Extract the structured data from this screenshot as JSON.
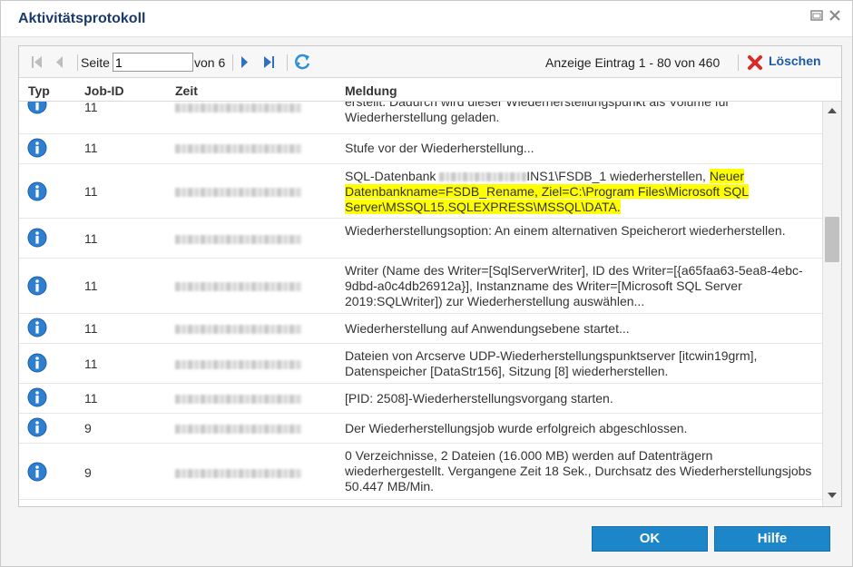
{
  "dialog": {
    "title": "Aktivitätsprotokoll",
    "window_buttons": [
      "restore-icon",
      "close-icon"
    ]
  },
  "toolbar": {
    "page_label": "Seite",
    "page_value": "1",
    "page_of": "von 6",
    "display_info": "Anzeige Eintrag 1 - 80 von 460",
    "delete_label": "Löschen",
    "icons": [
      "first-page-icon",
      "prev-page-icon",
      "next-page-icon",
      "last-page-icon",
      "refresh-icon",
      "delete-icon"
    ]
  },
  "grid": {
    "columns": [
      "Typ",
      "Job-ID",
      "Zeit",
      "Meldung"
    ],
    "rows": [
      {
        "type": "info-icon",
        "job_id": "11",
        "message": "erstellt. Dadurch wird dieser Wiederherstellungspunkt als Volume für Wiederherstellung geladen."
      },
      {
        "type": "info-icon",
        "job_id": "11",
        "message": "Stufe vor der Wiederherstellung..."
      },
      {
        "type": "info-icon",
        "job_id": "11",
        "message_pre": "SQL-Datenbank ",
        "message_mid": "INS1\\FSDB_1 wiederherstellen, ",
        "message_highlight": "Neuer Datenbankname=FSDB_Rename, Ziel=C:\\Program Files\\Microsoft SQL Server\\MSSQL15.SQLEXPRESS\\MSSQL\\DATA."
      },
      {
        "type": "info-icon",
        "job_id": "11",
        "message": "Wiederherstellungsoption: An einem alternativen Speicherort wiederherstellen."
      },
      {
        "type": "info-icon",
        "job_id": "11",
        "message": "Writer (Name des Writer=[SqlServerWriter], ID des Writer=[{a65faa63-5ea8-4ebc-9dbd-a0c4db26912a}], Instanzname des Writer=[Microsoft SQL Server 2019:SQLWriter]) zur Wiederherstellung auswählen..."
      },
      {
        "type": "info-icon",
        "job_id": "11",
        "message": "Wiederherstellung auf Anwendungsebene startet..."
      },
      {
        "type": "info-icon",
        "job_id": "11",
        "message": "Dateien von Arcserve UDP-Wiederherstellungspunktserver [itcwin19grm], Datenspeicher [DataStr156], Sitzung [8] wiederherstellen."
      },
      {
        "type": "info-icon",
        "job_id": "11",
        "message": "[PID: 2508]-Wiederherstellungsvorgang starten."
      },
      {
        "type": "info-icon",
        "job_id": "9",
        "message": "Der Wiederherstellungsjob wurde erfolgreich abgeschlossen."
      },
      {
        "type": "info-icon",
        "job_id": "9",
        "message": "0 Verzeichnisse, 2 Dateien (16.000 MB) werden auf Datenträgern wiederhergestellt. Vergangene Zeit 18 Sek., Durchsatz des Wiederherstellungsjobs 50.447 MB/Min."
      }
    ]
  },
  "footer": {
    "ok_label": "OK",
    "help_label": "Hilfe"
  },
  "colors": {
    "title": "#1b3a6b",
    "button": "#1d86c8",
    "highlight": "#ffff00",
    "info_icon": "#2f7fd0"
  }
}
